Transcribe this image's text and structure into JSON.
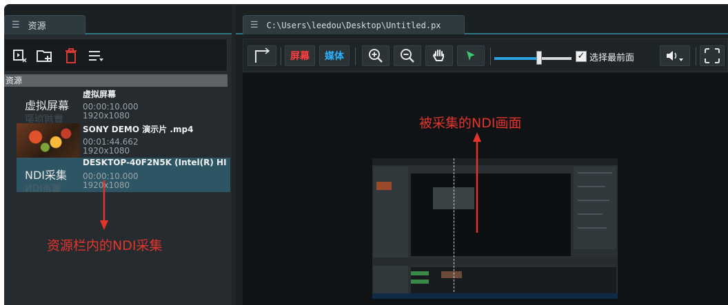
{
  "left_panel": {
    "tab_label": "资源",
    "tab_icon": "list-icon",
    "section_header": "资源",
    "toolbar_icons": [
      "add-capture-icon",
      "add-folder-icon",
      "delete-icon",
      "menu-icon"
    ],
    "items": [
      {
        "thumb_label": "虚拟屏幕",
        "thumb_reflection": "虚拟屏幕",
        "name": "虚拟屏幕",
        "duration": "00:00:10.000",
        "resolution": "1920x1080"
      },
      {
        "thumb_label": "",
        "thumb_reflection": "",
        "name": "SONY DEMO 演示片 .mp4",
        "duration": "00:01:44.662",
        "resolution": "1920x1080"
      },
      {
        "thumb_label": "NDI采集",
        "thumb_reflection": "NDI采集",
        "name": "DESKTOP-40F2N5K (Intel(R) HI",
        "duration": "00:00:10.000",
        "resolution": "1920x1080"
      }
    ]
  },
  "right_panel": {
    "tab_label": "C:\\Users\\leedou\\Desktop\\Untitled.px",
    "tab_icon": "list-icon",
    "screen_button": "屏幕",
    "media_button": "媒体",
    "zoom_slider_value": 0.58,
    "topmost_checkbox_checked": true,
    "topmost_label": "选择最前面",
    "toolbar_icons": [
      "crop-corner-icon",
      "zoom-in-icon",
      "zoom-out-icon",
      "hand-pan-icon",
      "select-arrow-icon",
      "speaker-icon",
      "frame-select-icon"
    ]
  },
  "annotations": {
    "captured_picture": "被采集的NDI画面",
    "resource_item": "资源栏内的NDI采集"
  },
  "colors": {
    "annotation": "#e3342c",
    "selection": "#2e5563",
    "accent_line": "#2e7485",
    "screen_button": "#ff3d3d",
    "media_button": "#2ab4ff"
  }
}
